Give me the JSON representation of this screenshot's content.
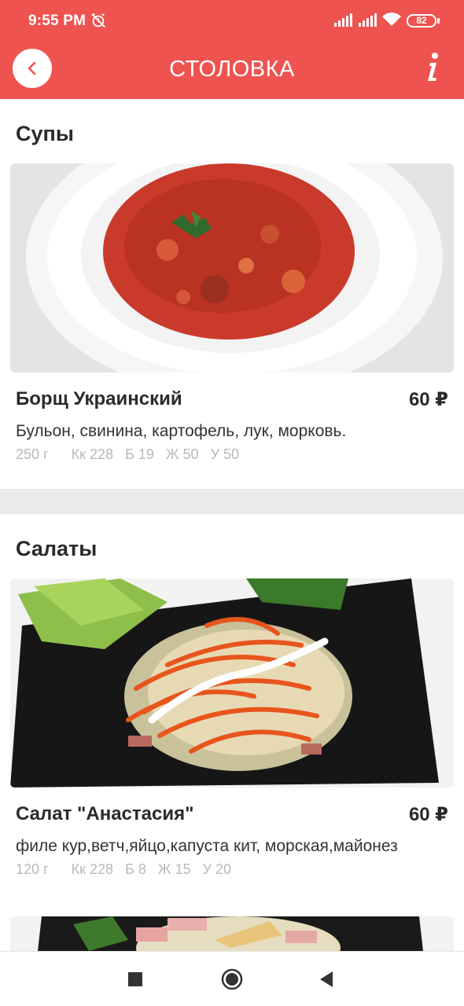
{
  "status_bar": {
    "time": "9:55 PM",
    "battery": "82"
  },
  "header": {
    "title": "СТОЛОВКА"
  },
  "sections": [
    {
      "title": "Супы",
      "item": {
        "name": "Борщ Украинский",
        "price": "60 ₽",
        "description": "Бульон, свинина, картофель, лук, морковь.",
        "weight": "250 г",
        "kcal": "Кк 228",
        "protein": "Б 19",
        "fat": "Ж 50",
        "carbs": "У 50"
      }
    },
    {
      "title": "Салаты",
      "item": {
        "name": "Салат \"Анастасия\"",
        "price": "60 ₽",
        "description": "филе кур,ветч,яйцо,капуста кит, морская,майонез",
        "weight": "120 г",
        "kcal": "Кк 228",
        "protein": "Б 8",
        "fat": "Ж 15",
        "carbs": "У 20"
      }
    }
  ],
  "colors": {
    "accent": "#ef5350",
    "divider": "#eaeaea",
    "muted_text": "#b9b9b9"
  },
  "icons": {
    "back": "chevron-left-icon",
    "info": "info-icon",
    "nav_recents": "square-icon",
    "nav_home": "circle-icon",
    "nav_back": "triangle-back-icon"
  }
}
